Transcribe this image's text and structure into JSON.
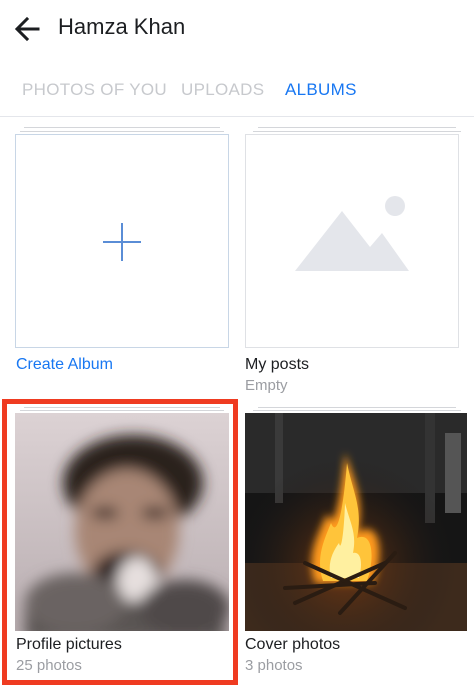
{
  "header": {
    "title": "Hamza Khan"
  },
  "tabs": [
    {
      "label": "PHOTOS OF YOU",
      "active": false
    },
    {
      "label": "UPLOADS",
      "active": false
    },
    {
      "label": "ALBUMS",
      "active": true
    }
  ],
  "albums": [
    {
      "title": "Create Album",
      "subtitle": "",
      "thumb": "plus-icon"
    },
    {
      "title": "My posts",
      "subtitle": "Empty",
      "thumb": "image-placeholder-icon"
    },
    {
      "title": "Profile pictures",
      "subtitle": "25 photos",
      "thumb": "blurred-profile-photo"
    },
    {
      "title": "Cover photos",
      "subtitle": "3 photos",
      "thumb": "bonfire-photo"
    }
  ],
  "colors": {
    "accent": "#1877f2",
    "highlight": "#ef3b21",
    "inactive_tab": "#c7c9cd"
  }
}
